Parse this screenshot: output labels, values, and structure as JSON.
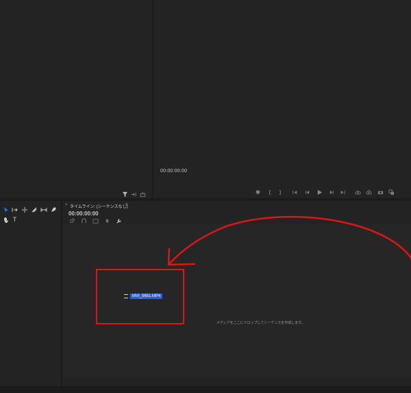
{
  "program": {
    "timecode": "00:00:00:00"
  },
  "timeline": {
    "title": "タイムライン: (シーケンスなし)",
    "close_glyph": "×",
    "menu_glyph": "≡",
    "timecode": "00:00:00:00",
    "drop_hint": "メディアをここにドロップしてシーケンスを作成します。"
  },
  "tools": {
    "type_tool_glyph": "T"
  },
  "clip": {
    "name": "MVI_5651.MP4"
  },
  "colors": {
    "panel": "#232323",
    "background": "#1b1b1b",
    "annotation_red": "#e01616",
    "selection_blue": "#2b5fd1"
  }
}
